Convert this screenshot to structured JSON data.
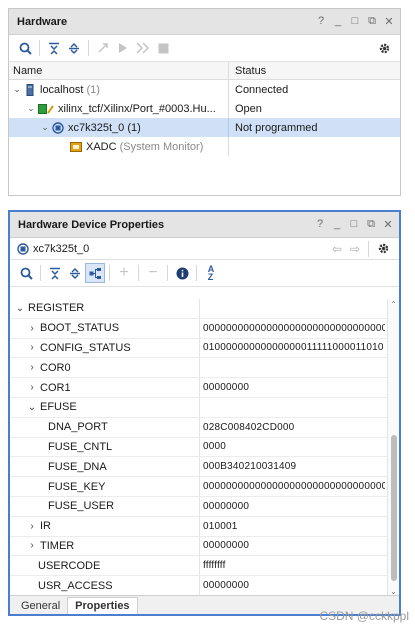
{
  "hardware_panel": {
    "title": "Hardware",
    "window_controls": [
      "?",
      "_",
      "□",
      "⧉",
      "✕"
    ],
    "columns": {
      "name": "Name",
      "status": "Status"
    },
    "tree": [
      {
        "label": "localhost",
        "suffix": "(1)",
        "status": "Connected",
        "icon": "server-icon"
      },
      {
        "label": "xilinx_tcf/Xilinx/Port_#0003.Hu...",
        "suffix": "",
        "status": "Open",
        "icon": "jtag-target-icon"
      },
      {
        "label": "xc7k325t_0",
        "suffix": "(1)",
        "status": "Not programmed",
        "icon": "fpga-device-icon"
      },
      {
        "label": "XADC",
        "suffix": "(System Monitor)",
        "status": "",
        "icon": "xadc-monitor-icon"
      }
    ]
  },
  "props_panel": {
    "title": "Hardware Device Properties",
    "window_controls": [
      "?",
      "_",
      "□",
      "⧉",
      "✕"
    ],
    "device_name": "xc7k325t_0",
    "rows": [
      {
        "name": "REGISTER",
        "value": "",
        "arrow": "⌄"
      },
      {
        "name": "BOOT_STATUS",
        "value": "00000000000000000000000000000000",
        "arrow": "›"
      },
      {
        "name": "CONFIG_STATUS",
        "value": "01000000000000000011111000011010",
        "arrow": "›"
      },
      {
        "name": "COR0",
        "value": "",
        "arrow": "›"
      },
      {
        "name": "COR1",
        "value": "00000000",
        "arrow": "›"
      },
      {
        "name": "EFUSE",
        "value": "",
        "arrow": "⌄"
      },
      {
        "name": "DNA_PORT",
        "value": "028C008402CD000",
        "arrow": ""
      },
      {
        "name": "FUSE_CNTL",
        "value": "0000",
        "arrow": ""
      },
      {
        "name": "FUSE_DNA",
        "value": "000B340210031409",
        "arrow": ""
      },
      {
        "name": "FUSE_KEY",
        "value": "00000000000000000000000000000000",
        "arrow": ""
      },
      {
        "name": "FUSE_USER",
        "value": "00000000",
        "arrow": ""
      },
      {
        "name": "IR",
        "value": "010001",
        "arrow": "›"
      },
      {
        "name": "TIMER",
        "value": "00000000",
        "arrow": "›"
      },
      {
        "name": "USERCODE",
        "value": "ffffffff",
        "arrow": ""
      },
      {
        "name": "USR_ACCESS",
        "value": "00000000",
        "arrow": ""
      }
    ],
    "tabs": [
      "General",
      "Properties"
    ]
  },
  "watermark": "CSDN @cckkppl",
  "colors": {
    "selection": "#cfe0f7",
    "accent": "#2c5a9c",
    "focus_border": "#4a7fd0"
  }
}
